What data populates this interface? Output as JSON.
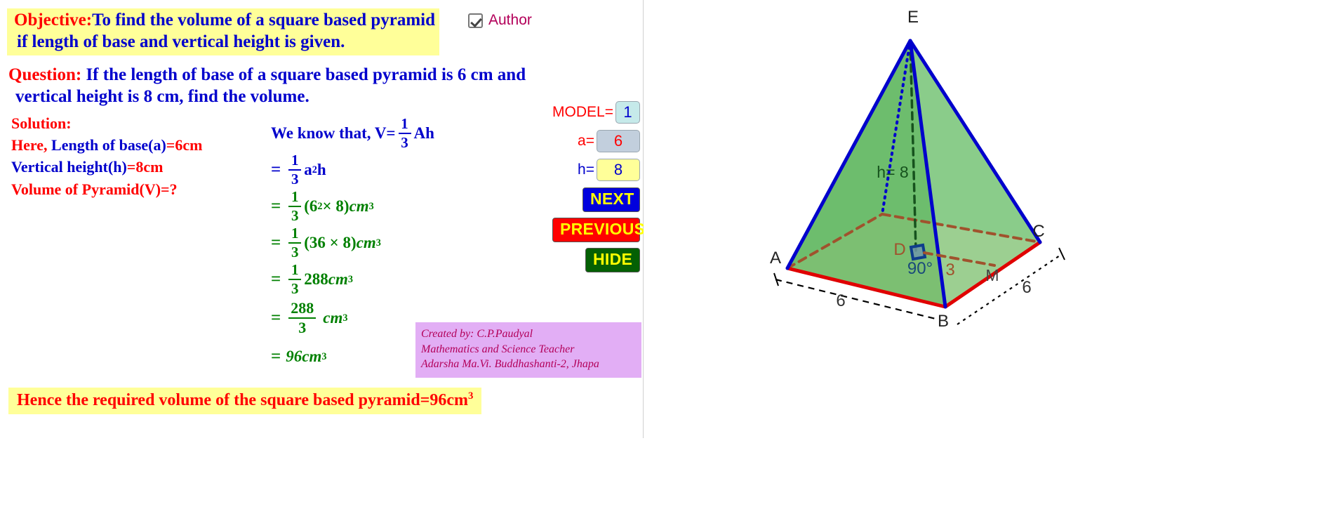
{
  "objective": {
    "label": "Objective:",
    "line1": "To find the volume of a square based pyramid",
    "line2": "if length of base and vertical height is given."
  },
  "author_toggle": {
    "label": "Author",
    "checked": true,
    "icon": "checkbox-checked-icon"
  },
  "question": {
    "label": "Question:",
    "line1": " If the length of base of a square based pyramid is 6 cm and",
    "line2": "vertical height is 8 cm, find the volume."
  },
  "solution": {
    "heading": "Solution:",
    "here_label": "Here,",
    "base_label": " Length of base(a)",
    "base_value": "=6cm",
    "height_label": "Vertical height(h)",
    "height_value": "=8cm",
    "unknown_line": "Volume of Pyramid(V)=?"
  },
  "derivation": {
    "intro": "We know that, V=",
    "intro_frac_num": "1",
    "intro_frac_den": "3",
    "intro_tail": "Ah",
    "steps": [
      {
        "eq": "=",
        "num": "1",
        "den": "3",
        "tail": "a",
        "sup": "2",
        "tail2": "h",
        "color": "blue"
      },
      {
        "eq": "=",
        "num": "1",
        "den": "3",
        "expr": "(6",
        "sup": "2",
        "expr2": " × 8)",
        "unit": "cm",
        "unit_sup": "3",
        "color": "green"
      },
      {
        "eq": "=",
        "num": "1",
        "den": "3",
        "expr": "(36 × 8)",
        "unit": "cm",
        "unit_sup": "3",
        "color": "green"
      },
      {
        "eq": "=",
        "num": "1",
        "den": "3",
        "expr": "288",
        "unit": "cm",
        "unit_sup": "3",
        "color": "green"
      },
      {
        "eq": "=",
        "num": "288",
        "den": "3",
        "expr": "",
        "unit": "cm",
        "unit_sup": "3",
        "color": "green"
      },
      {
        "eq": "=",
        "expr": "96",
        "unit": "cm",
        "unit_sup": "3",
        "color": "green"
      }
    ]
  },
  "controls": {
    "model_label": "MODEL=",
    "model_value": "1",
    "a_label": "a=",
    "a_value": "6",
    "h_label": "h=",
    "h_value": "8",
    "next_label": "NEXT",
    "previous_label": "PREVIOUS",
    "hide_label": "HIDE"
  },
  "created_by": {
    "line1": "Created by: C.P.Paudyal",
    "line2": "Mathematics and Science Teacher",
    "line3": "Adarsha Ma.Vi. Buddhashanti-2, Jhapa"
  },
  "conclusion": {
    "text": "Hence the required volume of the square based pyramid=96cm",
    "sup": "3"
  },
  "figure": {
    "title": "square-based-pyramid-3d",
    "vertices": {
      "A": "A",
      "B": "B",
      "C": "C",
      "D": "D",
      "E": "E",
      "M": "M"
    },
    "labels": {
      "height": "h= 8",
      "right_angle": "90°",
      "half_base": "3",
      "base_front": "6",
      "base_right": "6"
    },
    "colors": {
      "base_edge": "#e00000",
      "hidden_edge": "#a0522d",
      "lateral_edge": "#0000cc",
      "face_fill": "#66bb66",
      "base_fill": "#a9c98a",
      "height_line": "#16521d",
      "slant_dotted": "#0000cc",
      "label_dark": "#222222",
      "angle_label": "#1a4a7a"
    }
  },
  "theme": {
    "highlight": "#ffff99",
    "red": "#ff0000",
    "blue": "#0000cc",
    "green": "#008000",
    "crimson": "#b3005a",
    "purple_box": "#e2aef5"
  }
}
